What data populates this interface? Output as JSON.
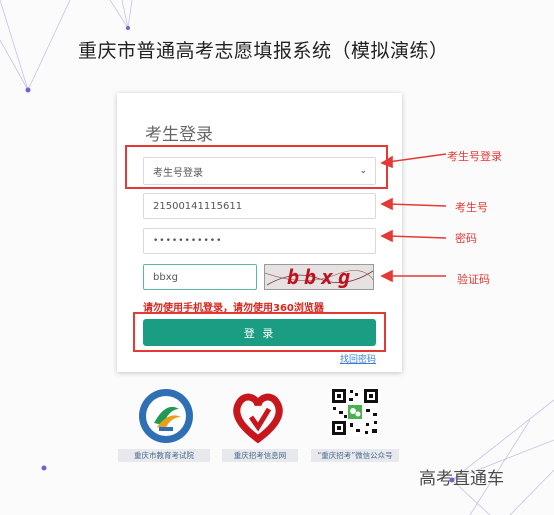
{
  "page": {
    "title": "重庆市普通高考志愿填报系统（模拟演练）"
  },
  "login": {
    "heading": "考生登录",
    "login_type_selected": "考生号登录",
    "candidate_number": "21500141115611",
    "password_masked": "•••••••••••",
    "captcha_input": "bbxg",
    "captcha_image_text": "bbxg",
    "warning": "请勿使用手机登录，请勿使用360浏览器",
    "submit_label": "登 录",
    "forgot_link": "找回密码"
  },
  "annotations": {
    "login_type": "考生号登录",
    "candidate_number": "考生号",
    "password": "密码",
    "captcha": "验证码"
  },
  "footer": {
    "links": [
      {
        "label": "重庆市教育考试院",
        "icon": "exam-authority-seal-icon"
      },
      {
        "label": "重庆招考信息网",
        "icon": "red-heart-logo-icon"
      },
      {
        "label": "“重庆招考”微信公众号",
        "icon": "qr-code-icon"
      }
    ]
  },
  "watermark": "高考直通车",
  "colors": {
    "accent": "#1a9d82",
    "annotation": "#e53935",
    "link": "#3a7fd5"
  }
}
